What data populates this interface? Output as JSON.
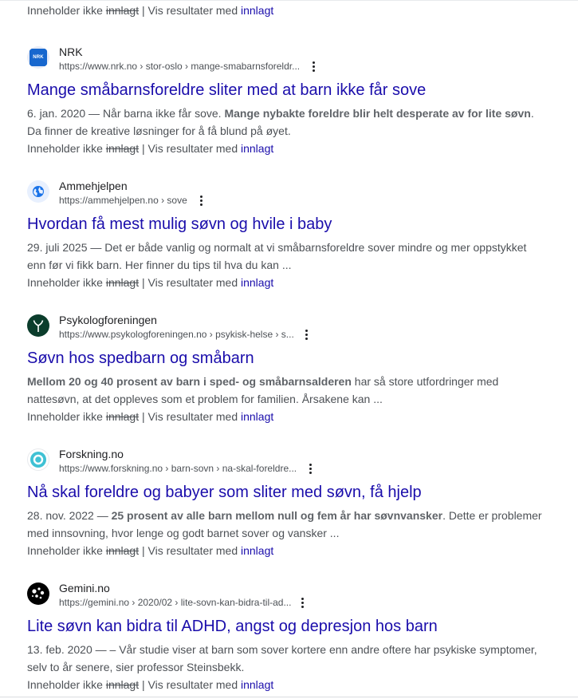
{
  "top_meta": {
    "contains_prefix": "Inneholder ikke",
    "excluded_term": "innlagt",
    "separator": "|",
    "show_results_prefix": "Vis resultater med",
    "show_results_term": "innlagt"
  },
  "results": [
    {
      "site_name": "NRK",
      "url": "https://www.nrk.no › stor-oslo › mange-smabarnsforeldr...",
      "favicon": {
        "icon": "nrk-logo-icon",
        "text": "NRK",
        "bg": "#1767ce"
      },
      "title": "Mange småbarnsforeldre sliter med at barn ikke får sove",
      "snippet_line1": {
        "plain": "6. jan. 2020 — Når barna ikke får sove. ",
        "bold": "Mange nybakte foreldre blir helt desperate av for lite søvn",
        "after": "."
      },
      "snippet_line2": "Da finner de kreative løsninger for å få blund på øyet.",
      "contains_prefix": "Inneholder ikke",
      "excluded_term": "innlagt",
      "separator": "|",
      "show_results_prefix": "Vis resultater med",
      "show_results_term": "innlagt"
    },
    {
      "site_name": "Ammehjelpen",
      "url": "https://ammehjelpen.no › sove",
      "favicon": {
        "icon": "globe-icon",
        "bg": "#e8f0fe"
      },
      "title": "Hvordan få mest mulig søvn og hvile i baby",
      "snippet_line1": {
        "plain": "29. juli 2025 — Det er både vanlig og normalt at vi småbarnsforeldre sover mindre og mer oppstykket",
        "bold": "",
        "after": ""
      },
      "snippet_line2": "enn før vi fikk barn. Her finner du tips til hva du kan ...",
      "contains_prefix": "Inneholder ikke",
      "excluded_term": "innlagt",
      "separator": "|",
      "show_results_prefix": "Vis resultater med",
      "show_results_term": "innlagt"
    },
    {
      "site_name": "Psykologforeningen",
      "url": "https://www.psykologforeningen.no › psykisk-helse › s...",
      "favicon": {
        "icon": "psykologforeningen-logo-icon",
        "bg": "#0b3d2c"
      },
      "title": "Søvn hos spedbarn og småbarn",
      "snippet_line1": {
        "plain": "",
        "bold": "Mellom 20 og 40 prosent av barn i sped- og småbarnsalderen",
        "after": " har så store utfordringer med"
      },
      "snippet_line2": "nattesøvn, at det oppleves som et problem for familien. Årsakene kan ...",
      "contains_prefix": "Inneholder ikke",
      "excluded_term": "innlagt",
      "separator": "|",
      "show_results_prefix": "Vis resultater med",
      "show_results_term": "innlagt"
    },
    {
      "site_name": "Forskning.no",
      "url": "https://www.forskning.no › barn-sovn › na-skal-foreldre...",
      "favicon": {
        "icon": "forskning-logo-icon",
        "bg": "#ffffff"
      },
      "title": "Nå skal foreldre og babyer som sliter med søvn, få hjelp",
      "snippet_line1": {
        "plain": "28. nov. 2022 — ",
        "bold": "25 prosent av alle barn mellom null og fem år har søvnvansker",
        "after": ". Dette er problemer"
      },
      "snippet_line2": "med innsovning, hvor lenge og godt barnet sover og vansker ...",
      "contains_prefix": "Inneholder ikke",
      "excluded_term": "innlagt",
      "separator": "|",
      "show_results_prefix": "Vis resultater med",
      "show_results_term": "innlagt"
    },
    {
      "site_name": "Gemini.no",
      "url": "https://gemini.no › 2020/02 › lite-sovn-kan-bidra-til-ad...",
      "favicon": {
        "icon": "gemini-logo-icon",
        "bg": "#000000"
      },
      "title": "Lite søvn kan bidra til ADHD, angst og depresjon hos barn",
      "snippet_line1": {
        "plain": "13. feb. 2020 — – Vår studie viser at barn som sover kortere enn andre oftere har psykiske symptomer,",
        "bold": "",
        "after": ""
      },
      "snippet_line2": "selv to år senere, sier professor Steinsbekk.",
      "contains_prefix": "Inneholder ikke",
      "excluded_term": "innlagt",
      "separator": "|",
      "show_results_prefix": "Vis resultater med",
      "show_results_term": "innlagt"
    }
  ]
}
